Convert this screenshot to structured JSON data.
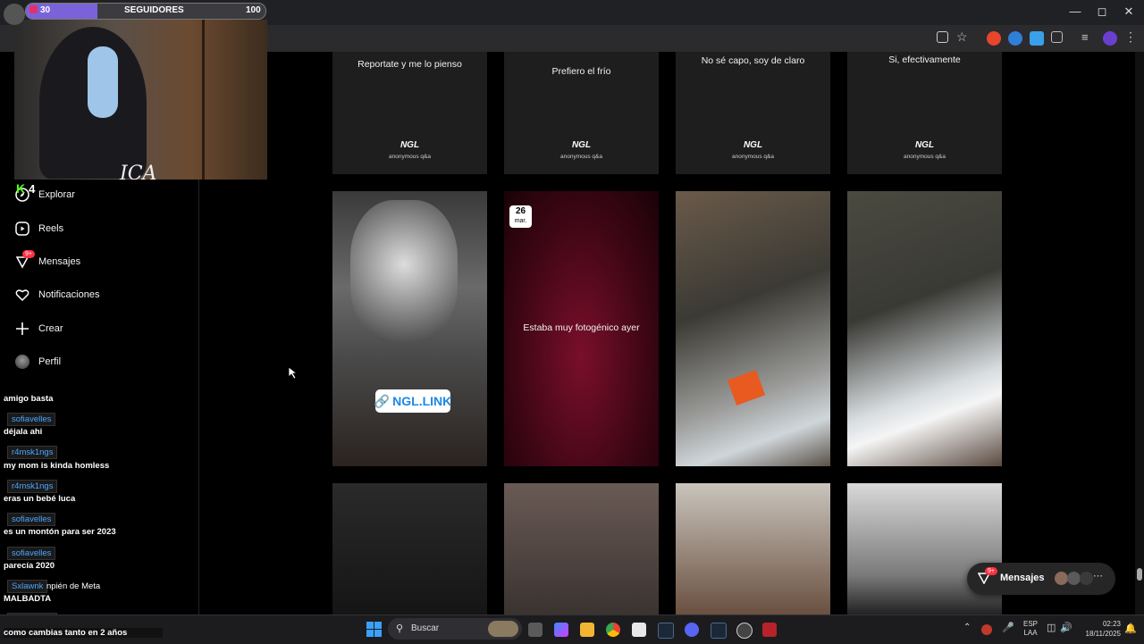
{
  "overlay": {
    "followers_label": "SEGUIDORES",
    "followers_current": "30",
    "followers_goal": "100",
    "progress_fraction": 0.3,
    "watermark_count": "4"
  },
  "nav": [
    {
      "label": "Explorar",
      "icon": "compass-icon"
    },
    {
      "label": "Reels",
      "icon": "reels-icon"
    },
    {
      "label": "Mensajes",
      "icon": "messenger-icon",
      "badge": "9+"
    },
    {
      "label": "Notificaciones",
      "icon": "heart-icon"
    },
    {
      "label": "Crear",
      "icon": "plus-icon"
    },
    {
      "label": "Perfil",
      "icon": "avatar-icon"
    }
  ],
  "chat": [
    {
      "user": "",
      "text": "amigo basta"
    },
    {
      "user": "sofiavelles",
      "text": "déjala ahi"
    },
    {
      "user": "r4msk1ngs",
      "text": "my mom is kinda homless"
    },
    {
      "user": "r4msk1ngs",
      "text": "eras un bebé luca"
    },
    {
      "user": "sofiavelles",
      "text": "es un montón para ser 2023"
    },
    {
      "user": "sofiavelles",
      "text": "parecía 2020"
    },
    {
      "user": "Sxlawnk",
      "text": "npién de Meta"
    },
    {
      "user": "",
      "text": "MALBADTA"
    },
    {
      "user": "r4msk1ngs",
      "text": "como cambias tanto en 2 años"
    }
  ],
  "posts_row1": [
    {
      "question": "Reportate y me lo pienso",
      "brand": "NGL",
      "sub": "anonymous q&a"
    },
    {
      "question": "Prefiero el frío",
      "brand": "NGL",
      "sub": "anonymous q&a"
    },
    {
      "question": "No sé capo, soy de claro",
      "brand": "NGL",
      "sub": "anonymous q&a"
    },
    {
      "question": "Si, efectivamente",
      "brand": "NGL",
      "sub": "anonymous q&a"
    }
  ],
  "posts_row2": {
    "ngl_link": "NGL.LINK",
    "date_day": "26",
    "date_month": "mar.",
    "caption": "Estaba muy fotogénico ayer"
  },
  "messages_bubble": {
    "label": "Mensajes",
    "badge": "9+"
  },
  "taskbar": {
    "search_placeholder": "Buscar",
    "lang_top": "ESP",
    "lang_bottom": "LAA",
    "time": "02:23",
    "date": "18/11/2025"
  }
}
